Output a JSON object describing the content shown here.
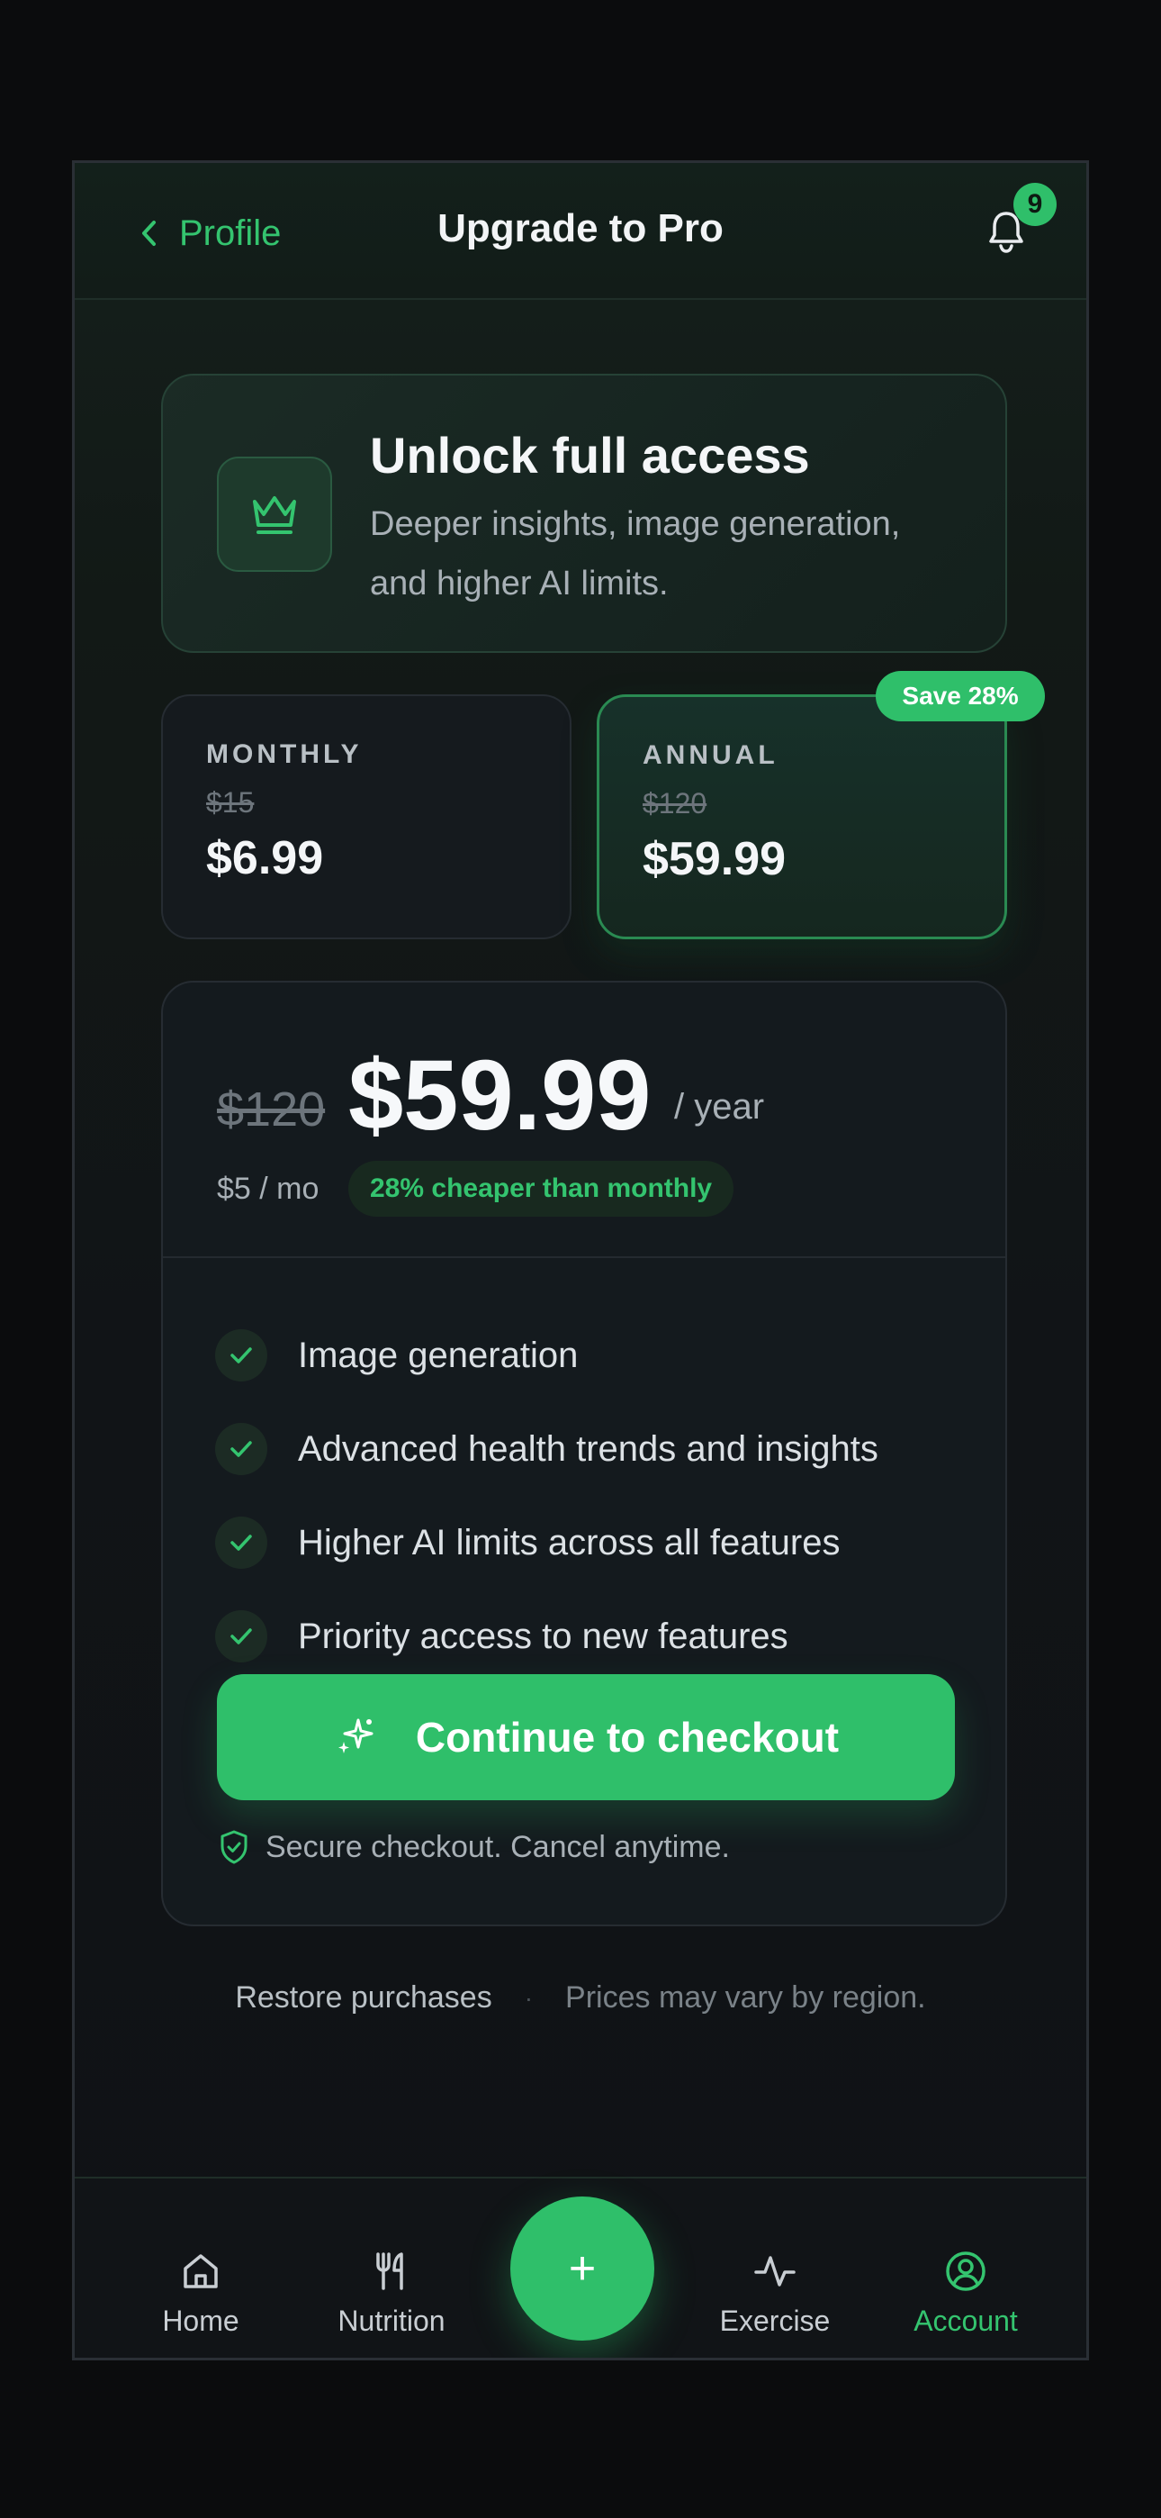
{
  "header": {
    "back_label": "Profile",
    "title": "Upgrade to Pro",
    "notification_count": "9"
  },
  "hero": {
    "icon": "crown-icon",
    "title": "Unlock full access",
    "subtitle": "Deeper insights, image generation, and higher AI limits."
  },
  "plans": [
    {
      "label": "MONTHLY",
      "old_price": "$15",
      "price": "$6.99",
      "selected": false
    },
    {
      "label": "ANNUAL",
      "old_price": "$120",
      "price": "$59.99",
      "selected": true,
      "badge": "Save 28%"
    }
  ],
  "summary": {
    "old_price": "$120",
    "price": "$59.99",
    "unit": "/ year",
    "per_month": "$5 / mo",
    "cheaper_badge": "28% cheaper than monthly"
  },
  "features": [
    "Image generation",
    "Advanced health trends and insights",
    "Higher AI limits across all features",
    "Priority access to new features"
  ],
  "cta": {
    "label": "Continue to checkout",
    "icon": "sparkles-icon"
  },
  "secure_note": "Secure checkout. Cancel anytime.",
  "footer": {
    "restore": "Restore purchases",
    "separator": "·",
    "note": "Prices may vary by region."
  },
  "tabbar": {
    "items": [
      {
        "label": "Home",
        "icon": "home-icon"
      },
      {
        "label": "Nutrition",
        "icon": "fork-knife-icon"
      },
      {
        "label": "Exercise",
        "icon": "activity-icon"
      },
      {
        "label": "Account",
        "icon": "account-icon",
        "active": true
      }
    ],
    "fab": "+"
  },
  "colors": {
    "accent": "#2fbf6a",
    "background": "#111417",
    "text_muted": "#a8b0b6"
  }
}
